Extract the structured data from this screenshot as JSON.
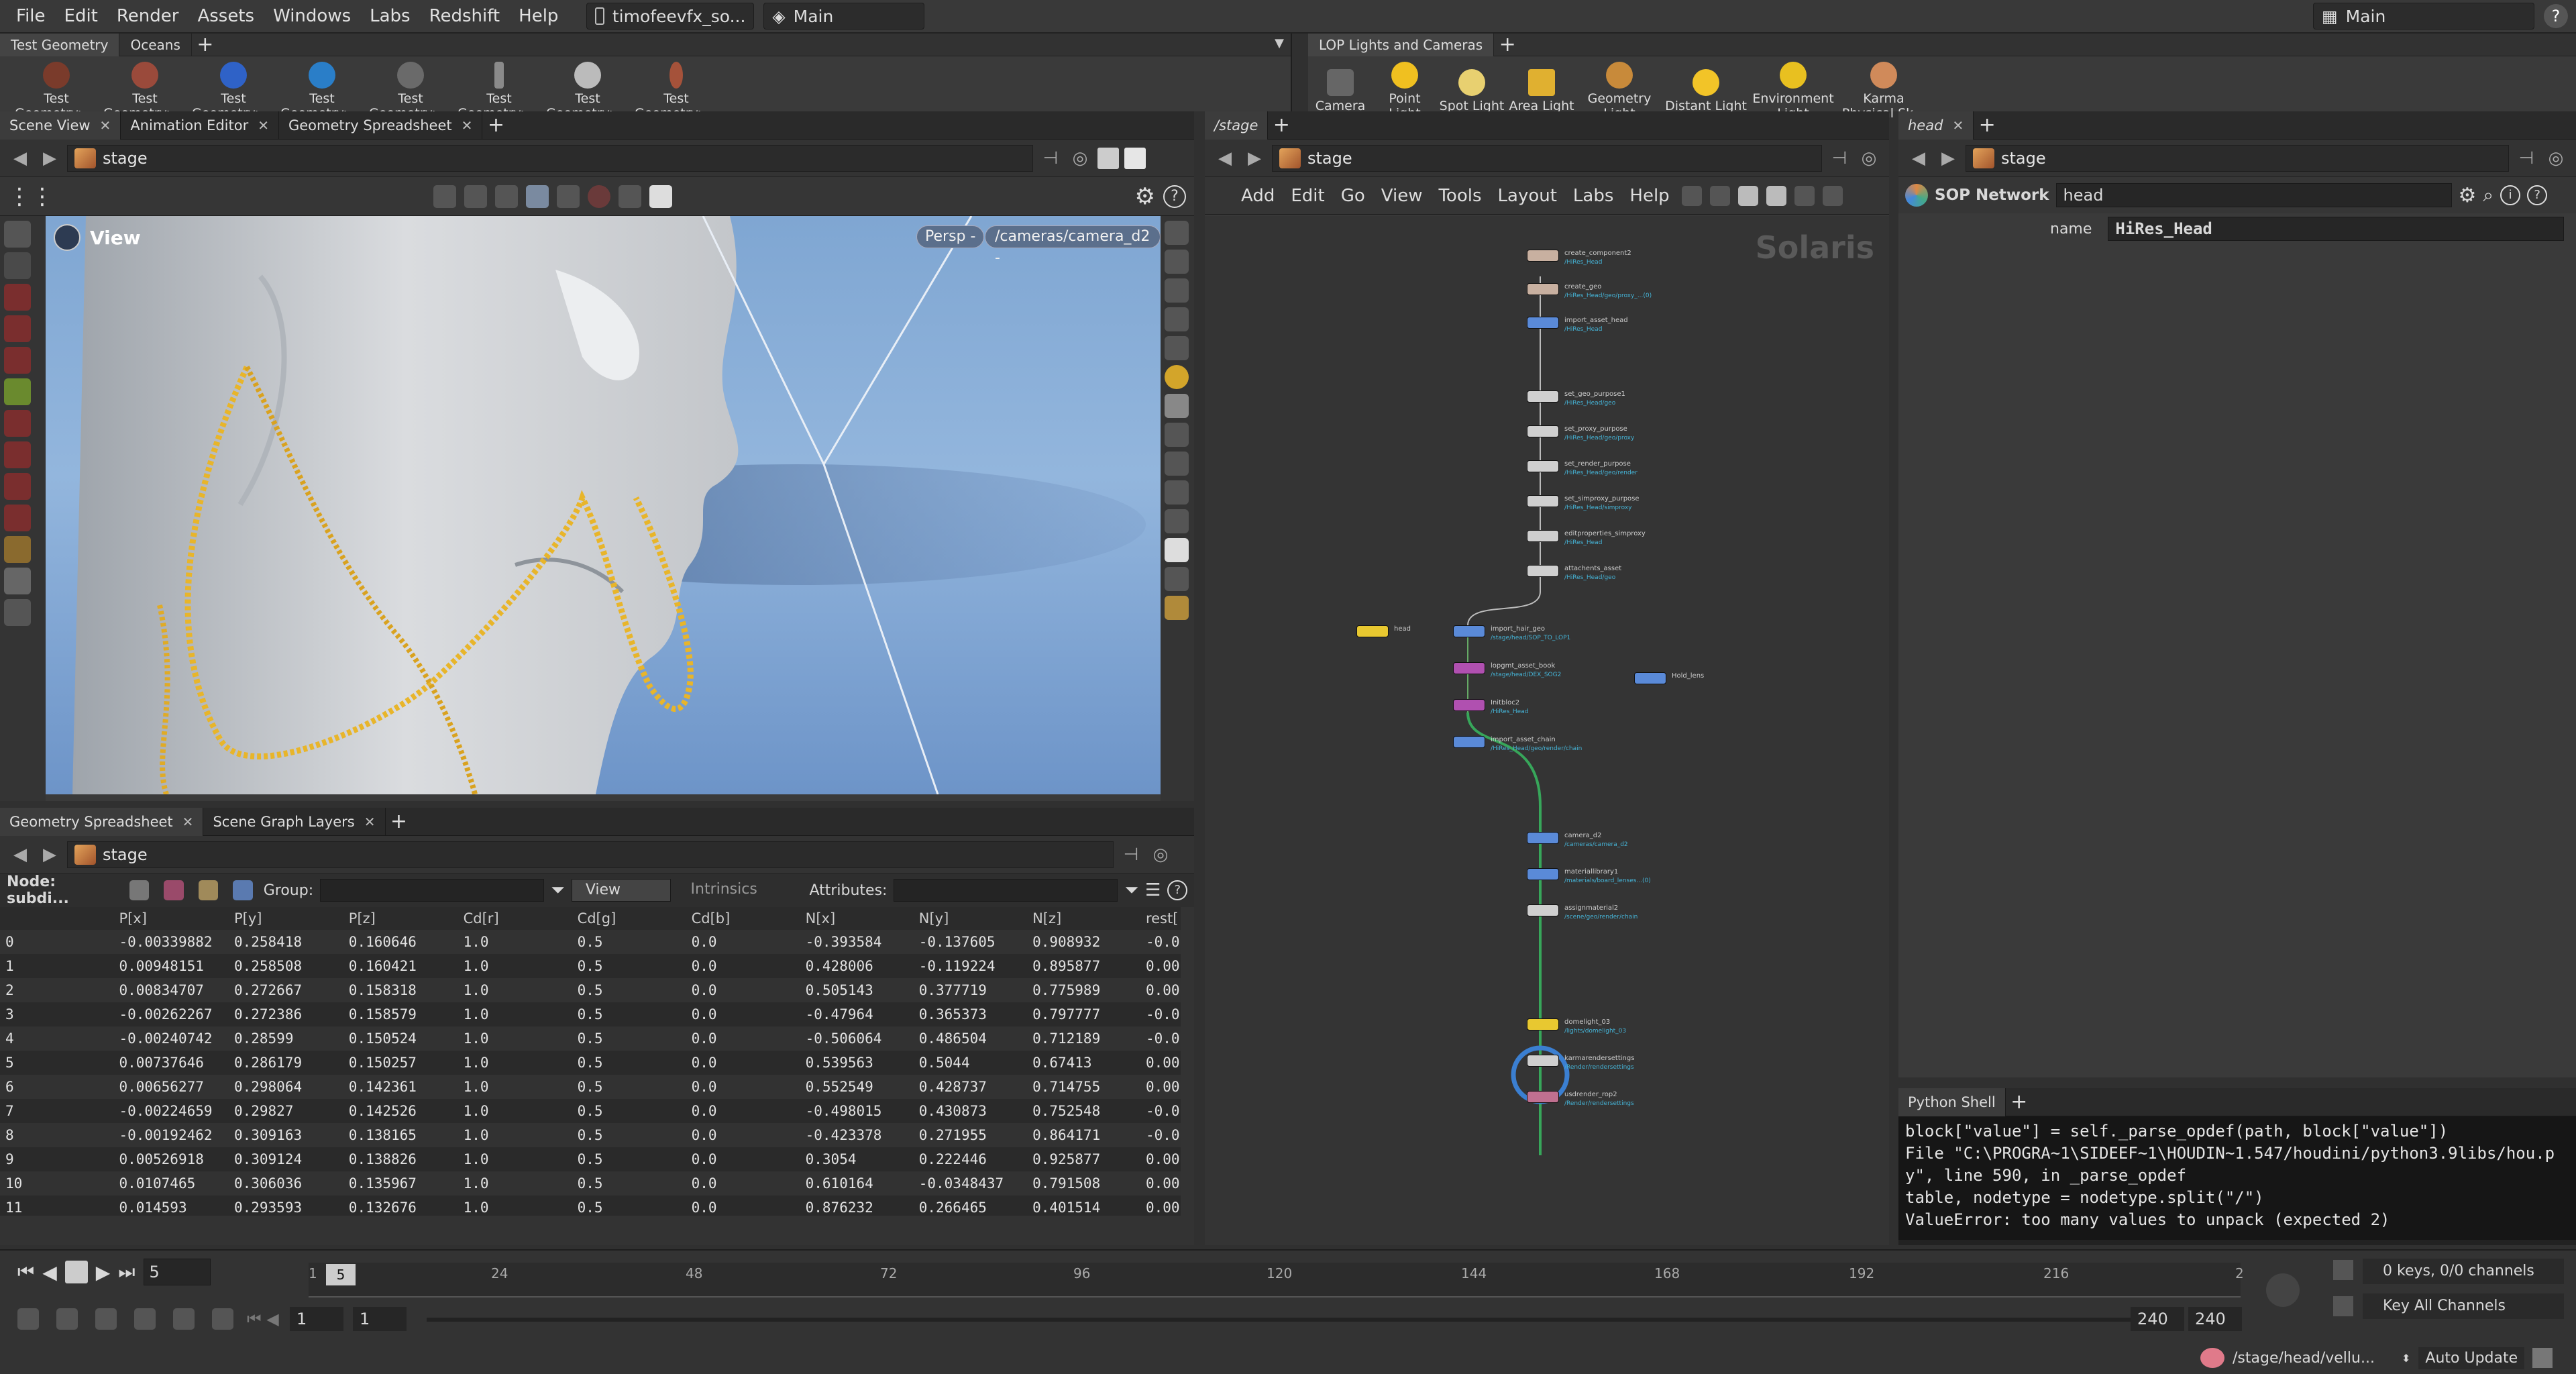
{
  "menubar": {
    "items": [
      "File",
      "Edit",
      "Render",
      "Assets",
      "Windows",
      "Labs",
      "Redshift",
      "Help"
    ],
    "scene_file": "timofeevfx_so...",
    "desktop": "Main",
    "right_desktop": "Main"
  },
  "shelf_left": {
    "tabs": [
      "Test Geometry",
      "Oceans"
    ],
    "tools": [
      "Test Geometry: ...",
      "Test Geometry: ...",
      "Test Geometry: ...",
      "Test Geometry: ...",
      "Test Geometry: ...",
      "Test Geometry: ...",
      "Test Geometry: ...",
      "Test Geometry: ..."
    ]
  },
  "shelf_right": {
    "tabs": [
      "LOP Lights and Cameras"
    ],
    "tools": [
      "Camera",
      "Point Light",
      "Spot Light",
      "Area Light",
      "Geometry Light",
      "Distant Light",
      "Environment Light",
      "Karma Physical Sk..."
    ]
  },
  "viewer": {
    "tabs": [
      "Scene View",
      "Animation Editor",
      "Geometry Spreadsheet"
    ],
    "path": "stage",
    "label": "View",
    "persp": "Persp -",
    "camera": "/cameras/camera_d2 -"
  },
  "spreadsheet": {
    "tabs": [
      "Geometry Spreadsheet",
      "Scene Graph Layers"
    ],
    "path": "stage",
    "node": "Node: subdi...",
    "group_label": "Group:",
    "view_label": "View",
    "intrinsics_label": "Intrinsics",
    "attributes_label": "Attributes:",
    "columns": [
      "",
      "P[x]",
      "P[y]",
      "P[z]",
      "Cd[r]",
      "Cd[g]",
      "Cd[b]",
      "N[x]",
      "N[y]",
      "N[z]",
      "rest["
    ],
    "rows": [
      [
        "0",
        "-0.00339882",
        "0.258418",
        "0.160646",
        "1.0",
        "0.5",
        "0.0",
        "-0.393584",
        "-0.137605",
        "0.908932",
        "-0.0"
      ],
      [
        "1",
        "0.00948151",
        "0.258508",
        "0.160421",
        "1.0",
        "0.5",
        "0.0",
        "0.428006",
        "-0.119224",
        "0.895877",
        "0.00"
      ],
      [
        "2",
        "0.00834707",
        "0.272667",
        "0.158318",
        "1.0",
        "0.5",
        "0.0",
        "0.505143",
        "0.377719",
        "0.775989",
        "0.00"
      ],
      [
        "3",
        "-0.00262267",
        "0.272386",
        "0.158579",
        "1.0",
        "0.5",
        "0.0",
        "-0.47964",
        "0.365373",
        "0.797777",
        "-0.0"
      ],
      [
        "4",
        "-0.00240742",
        "0.28599",
        "0.150524",
        "1.0",
        "0.5",
        "0.0",
        "-0.506064",
        "0.486504",
        "0.712189",
        "-0.0"
      ],
      [
        "5",
        "0.00737646",
        "0.286179",
        "0.150257",
        "1.0",
        "0.5",
        "0.0",
        "0.539563",
        "0.5044",
        "0.67413",
        "0.00"
      ],
      [
        "6",
        "0.00656277",
        "0.298064",
        "0.142361",
        "1.0",
        "0.5",
        "0.0",
        "0.552549",
        "0.428737",
        "0.714755",
        "0.00"
      ],
      [
        "7",
        "-0.00224659",
        "0.29827",
        "0.142526",
        "1.0",
        "0.5",
        "0.0",
        "-0.498015",
        "0.430873",
        "0.752548",
        "-0.0"
      ],
      [
        "8",
        "-0.00192462",
        "0.309163",
        "0.138165",
        "1.0",
        "0.5",
        "0.0",
        "-0.423378",
        "0.271955",
        "0.864171",
        "-0.0"
      ],
      [
        "9",
        "0.00526918",
        "0.309124",
        "0.138826",
        "1.0",
        "0.5",
        "0.0",
        "0.3054",
        "0.222446",
        "0.925877",
        "0.00"
      ],
      [
        "10",
        "0.0107465",
        "0.306036",
        "0.135967",
        "1.0",
        "0.5",
        "0.0",
        "0.610164",
        "-0.0348437",
        "0.791508",
        "0.00"
      ],
      [
        "11",
        "0.014593",
        "0.293593",
        "0.132676",
        "1.0",
        "0.5",
        "0.0",
        "0.876232",
        "0.266465",
        "0.401514",
        "0.00"
      ]
    ]
  },
  "network": {
    "tab": "/stage",
    "path": "stage",
    "menus": [
      "Add",
      "Edit",
      "Go",
      "View",
      "Tools",
      "Layout",
      "Labs",
      "Help"
    ],
    "watermark": "Solaris",
    "nodes": [
      {
        "name": "create_component2",
        "sub": "/HiRes_Head"
      },
      {
        "name": "create_geo",
        "sub": "/HiRes_Head/geo/proxy_...(0)"
      },
      {
        "name": "import_asset_head",
        "sub": "/HiRes_Head"
      },
      {
        "name": "set_geo_purpose1",
        "sub": "/HiRes_Head/geo"
      },
      {
        "name": "set_proxy_purpose",
        "sub": "/HiRes_Head/geo/proxy"
      },
      {
        "name": "set_render_purpose",
        "sub": "/HiRes_Head/geo/render"
      },
      {
        "name": "set_simproxy_purpose",
        "sub": "/HiRes_Head/simproxy"
      },
      {
        "name": "editproperties_simproxy",
        "sub": "/HiRes_Head"
      },
      {
        "name": "attachents_asset",
        "sub": "/HiRes_Head/geo"
      },
      {
        "name": "head",
        "sub": ""
      },
      {
        "name": "import_hair_geo",
        "sub": "/stage/head/SOP_TO_LOP1"
      },
      {
        "name": "lopgmt_asset_book",
        "sub": "/stage/head/DEX_SOG2"
      },
      {
        "name": "Initbloc2",
        "sub": "/HiRes_Head"
      },
      {
        "name": "import_asset_chain",
        "sub": "/HiRes_Head/geo/render/chain"
      },
      {
        "name": "Hold_lens",
        "sub": ""
      },
      {
        "name": "camera_d2",
        "sub": "/cameras/camera_d2"
      },
      {
        "name": "materiallibrary1",
        "sub": "/materials/board_lenses...(0)"
      },
      {
        "name": "assignmaterial2",
        "sub": "/scene/geo/render/chain"
      },
      {
        "name": "domelight_03",
        "sub": "/lights/domelight_03"
      },
      {
        "name": "karmarendersettings",
        "sub": "/Render/rendersettings"
      },
      {
        "name": "usdrender_rop2",
        "sub": "/Render/rendersettings"
      }
    ]
  },
  "params": {
    "tab": "head",
    "path": "stage",
    "network_label": "SOP Network",
    "node_name": "head",
    "param_label": "name",
    "param_value": "HiRes_Head"
  },
  "python": {
    "tab": "Python Shell",
    "lines": [
      "    block[\"value\"] = self._parse_opdef(path, block[\"value\"])",
      "  File \"C:\\PROGRA~1\\SIDEEF~1\\HOUDIN~1.547/houdini/python3.9libs/hou.py\", line 590, in _parse_opdef",
      "    table, nodetype = nodetype.split(\"/\")",
      "ValueError: too many values to unpack (expected 2)"
    ]
  },
  "timeline": {
    "current_frame": "5",
    "frame_marker": "5",
    "ticks": [
      "1",
      "24",
      "48",
      "72",
      "96",
      "120",
      "144",
      "168",
      "192",
      "216",
      "2"
    ],
    "range_start": "1",
    "range_start2": "1",
    "range_end": "240",
    "range_end2": "240",
    "keys": "0 keys, 0/0 channels",
    "key_all": "Key All Channels",
    "status_path": "/stage/head/vellu...",
    "auto_update": "Auto Update"
  }
}
